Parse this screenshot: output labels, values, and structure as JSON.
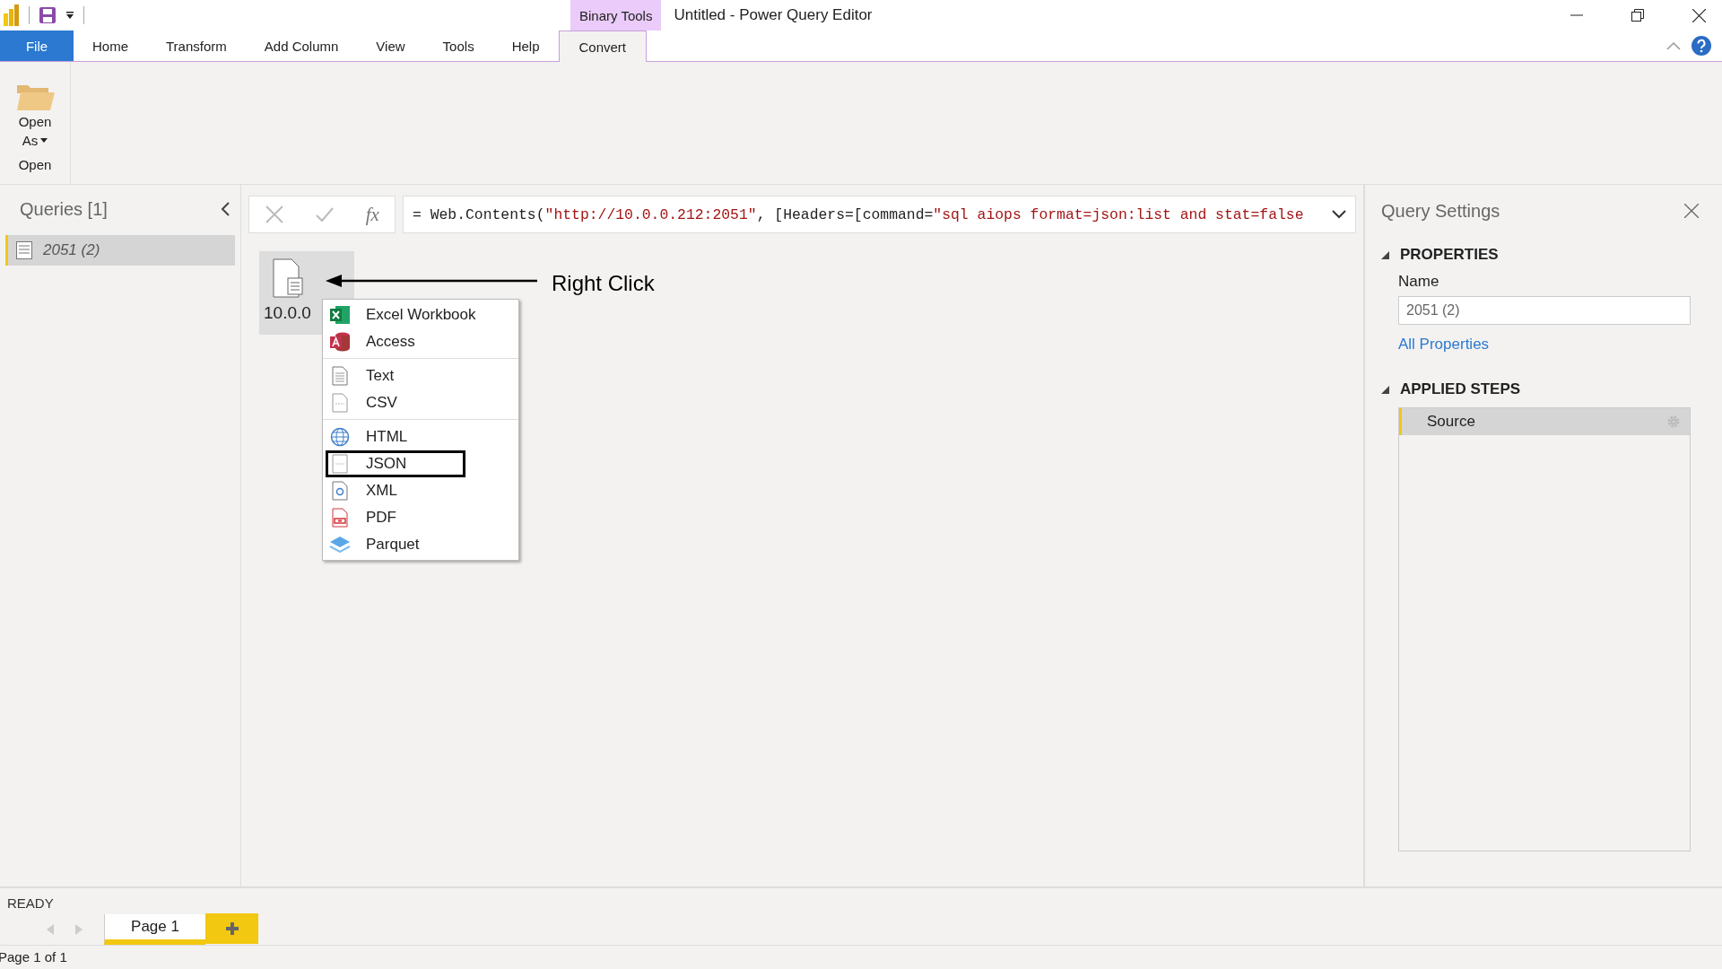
{
  "window": {
    "title": "Untitled - Power Query Editor",
    "context_tab_group": "Binary Tools"
  },
  "ribbon": {
    "tabs": [
      {
        "label": "File",
        "kind": "file",
        "selected": false
      },
      {
        "label": "Home",
        "kind": "tab",
        "selected": false
      },
      {
        "label": "Transform",
        "kind": "tab",
        "selected": false
      },
      {
        "label": "Add Column",
        "kind": "tab",
        "selected": false
      },
      {
        "label": "View",
        "kind": "tab",
        "selected": false
      },
      {
        "label": "Tools",
        "kind": "tab",
        "selected": false
      },
      {
        "label": "Help",
        "kind": "tab",
        "selected": false
      },
      {
        "label": "Convert",
        "kind": "context",
        "selected": true
      }
    ],
    "groups": [
      {
        "label": "Open",
        "buttons": [
          {
            "label_lines": [
              "Open",
              "As"
            ]
          }
        ]
      }
    ]
  },
  "queries": {
    "title": "Queries [1]",
    "items": [
      {
        "label": "2051 (2)",
        "selected": true
      }
    ]
  },
  "formula_bar": {
    "fx_label": "fx",
    "segments": [
      {
        "kind": "code",
        "text": "= Web.Contents("
      },
      {
        "kind": "string",
        "text": "\"http://10.0.0.212:2051\""
      },
      {
        "kind": "code",
        "text": ", [Headers=[command="
      },
      {
        "kind": "string",
        "text": "\"sql aiops format=json:list and stat=false"
      }
    ]
  },
  "preview": {
    "binary_label": "10.0.0",
    "annotation": "Right Click"
  },
  "context_menu": {
    "groups": [
      [
        {
          "label": "Excel Workbook",
          "kind": "excel",
          "highlighted": false
        },
        {
          "label": "Access",
          "kind": "access",
          "highlighted": false
        }
      ],
      [
        {
          "label": "Text",
          "kind": "text",
          "highlighted": false
        },
        {
          "label": "CSV",
          "kind": "csv",
          "highlighted": false
        }
      ],
      [
        {
          "label": "HTML",
          "kind": "html",
          "highlighted": false
        },
        {
          "label": "JSON",
          "kind": "json",
          "highlighted": true
        },
        {
          "label": "XML",
          "kind": "xml",
          "highlighted": false
        },
        {
          "label": "PDF",
          "kind": "pdf",
          "highlighted": false
        },
        {
          "label": "Parquet",
          "kind": "parquet",
          "highlighted": false
        }
      ]
    ]
  },
  "query_settings": {
    "title": "Query Settings",
    "properties_heading": "PROPERTIES",
    "name_label": "Name",
    "name_value": "2051 (2)",
    "all_properties_link": "All Properties",
    "applied_steps_heading": "APPLIED STEPS",
    "steps": [
      {
        "label": "Source",
        "selected": true
      }
    ]
  },
  "status_bar": {
    "status": "READY",
    "pages": [
      {
        "label": "Page 1",
        "selected": true
      }
    ],
    "page_count": "Page 1 of 1"
  }
}
